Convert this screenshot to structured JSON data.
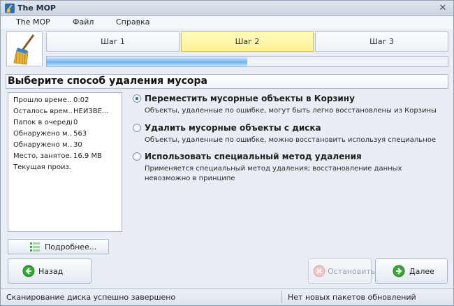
{
  "window": {
    "title": "The MOP",
    "close_glyph": "✕",
    "icon": "broom-icon"
  },
  "menu": {
    "items": [
      "The MOP",
      "Файл",
      "Справка"
    ]
  },
  "steps": [
    {
      "label": "Шаг 1",
      "active": false
    },
    {
      "label": "Шаг 2",
      "active": true
    },
    {
      "label": "Шаг 3",
      "active": false
    }
  ],
  "progress": {
    "fraction": 0.5
  },
  "section": {
    "title": "Выберите способ удаления мусора"
  },
  "info": [
    {
      "label": "Прошло време...",
      "value": "0:02"
    },
    {
      "label": "Осталось врем...",
      "value": "НЕИЗВЕ..."
    },
    {
      "label": "Папок в очереди",
      "value": "0"
    },
    {
      "label": "Обнаружено м...",
      "value": "563"
    },
    {
      "label": "Обнаружено м...",
      "value": "30"
    },
    {
      "label": "Место, занятое...",
      "value": "16.9 MB"
    },
    {
      "label": "Текущая произ...",
      "value": ""
    }
  ],
  "details_button": {
    "label": "Подробнее...",
    "icon": "list-icon"
  },
  "options": [
    {
      "title": "Переместить мусорные объекты в Корзину",
      "description": "Объекты, удаленные по ошибке, могут быть легко восстановлены из Корзины",
      "checked": true
    },
    {
      "title": "Удалить мусорные объекты с диска",
      "description": "Объекты, удаленные по ошибке, можно восстановить используя специальное",
      "checked": false
    },
    {
      "title": "Использовать специальный метод удаления",
      "description": "Применяется специальный метод удаления; восстановление данных невозможно в принципе",
      "checked": false
    }
  ],
  "buttons": {
    "back": {
      "label": "Назад",
      "icon": "arrow-left-icon",
      "enabled": true
    },
    "stop": {
      "label": "Остановить",
      "icon": "stop-icon",
      "enabled": false
    },
    "next": {
      "label": "Далее",
      "icon": "arrow-right-icon",
      "enabled": true
    }
  },
  "status": {
    "left": "Сканирование диска успешно завершено",
    "right": "Нет новых пакетов обновлений"
  },
  "colors": {
    "accent": "#2f9b2f",
    "active_step": "#fff3a0",
    "progress": "#6fb3ef"
  }
}
